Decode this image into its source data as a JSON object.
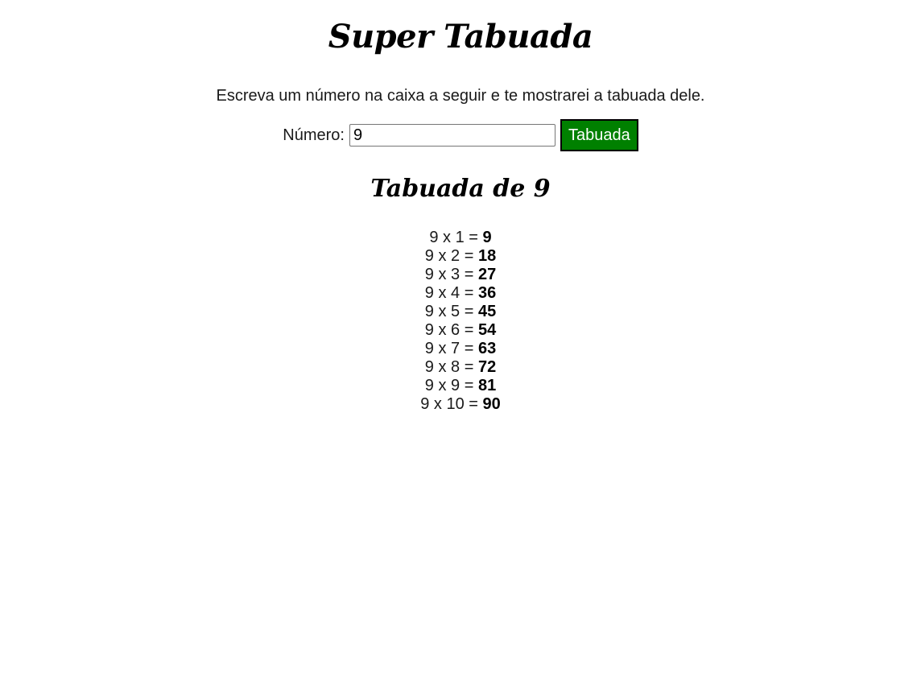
{
  "header": {
    "title": "Super Tabuada",
    "intro": "Escreva um número na caixa a seguir e te mostrarei a tabuada dele."
  },
  "form": {
    "label": "Número:",
    "value": "9",
    "button_label": "Tabuada"
  },
  "result": {
    "title": "Tabuada de 9",
    "rows": [
      {
        "expr": "9 x 1 = ",
        "value": "9"
      },
      {
        "expr": "9 x 2 = ",
        "value": "18"
      },
      {
        "expr": "9 x 3 = ",
        "value": "27"
      },
      {
        "expr": "9 x 4 = ",
        "value": "36"
      },
      {
        "expr": "9 x 5 = ",
        "value": "45"
      },
      {
        "expr": "9 x 6 = ",
        "value": "54"
      },
      {
        "expr": "9 x 7 = ",
        "value": "63"
      },
      {
        "expr": "9 x 8 = ",
        "value": "72"
      },
      {
        "expr": "9 x 9 = ",
        "value": "81"
      },
      {
        "expr": "9 x 10 = ",
        "value": "90"
      }
    ]
  },
  "colors": {
    "button_bg": "#008000",
    "button_text": "#ffffff",
    "button_border": "#000000"
  }
}
